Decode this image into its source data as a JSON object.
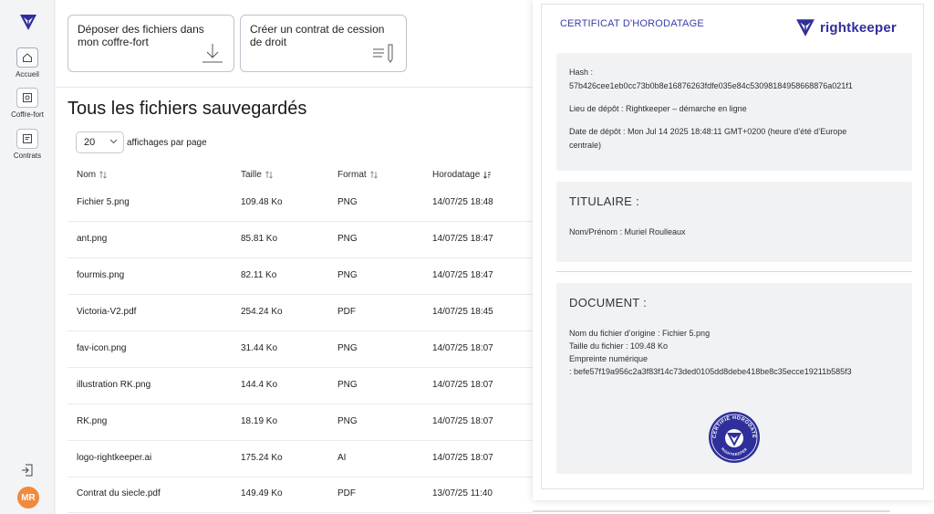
{
  "sidebar": {
    "items": [
      {
        "label": "Accueil",
        "icon": "home-icon"
      },
      {
        "label": "Coffre-fort",
        "icon": "safe-icon"
      },
      {
        "label": "Contrats",
        "icon": "contract-icon"
      }
    ],
    "avatar_initials": "MR"
  },
  "actions": {
    "upload_label": "Déposer des fichiers dans mon coffre-fort",
    "contract_label": "Créer un contrat de cession de droit"
  },
  "files": {
    "title": "Tous les fichiers sauvegardés",
    "page_size": "20",
    "page_size_label": "affichages par page",
    "columns": {
      "name": "Nom",
      "size": "Taille",
      "format": "Format",
      "date": "Horodatage"
    },
    "rows": [
      {
        "name": "Fichier 5.png",
        "size": "109.48 Ko",
        "format": "PNG",
        "date": "14/07/25 18:48"
      },
      {
        "name": "ant.png",
        "size": "85.81 Ko",
        "format": "PNG",
        "date": "14/07/25 18:47"
      },
      {
        "name": "fourmis.png",
        "size": "82.11 Ko",
        "format": "PNG",
        "date": "14/07/25 18:47"
      },
      {
        "name": "Victoria-V2.pdf",
        "size": "254.24 Ko",
        "format": "PDF",
        "date": "14/07/25 18:45"
      },
      {
        "name": "fav-icon.png",
        "size": "31.44 Ko",
        "format": "PNG",
        "date": "14/07/25 18:07"
      },
      {
        "name": "illustration RK.png",
        "size": "144.4 Ko",
        "format": "PNG",
        "date": "14/07/25 18:07"
      },
      {
        "name": "RK.png",
        "size": "18.19 Ko",
        "format": "PNG",
        "date": "14/07/25 18:07"
      },
      {
        "name": "logo-rightkeeper.ai",
        "size": "175.24 Ko",
        "format": "AI",
        "date": "14/07/25 18:07"
      },
      {
        "name": "Contrat du siecle.pdf",
        "size": "149.49 Ko",
        "format": "PDF",
        "date": "13/07/25 11:40"
      }
    ]
  },
  "certificate": {
    "title": "CERTIFICAT D'HORODATAGE",
    "brand": "rightkeeper",
    "hash_label": "Hash :",
    "hash_value": "57b426cee1eb0cc73b0b8e16876263fdfe035e84c530981849586688 76a021f1",
    "place": "Lieu de dépôt : Rightkeeper – démarche en ligne",
    "date_line1": "Date de dépôt : Mon Jul 14 2025 18:48:11 GMT+0200 (heure d’été d’Europe",
    "date_line2": "centrale)",
    "holder_heading": "TITULAIRE :",
    "holder_name": "Nom/Prénom : Muriel Roulleaux",
    "doc_heading": "DOCUMENT :",
    "doc_original": "Nom du fichier d’origine : Fichier 5.png",
    "doc_size": "Taille du fichier : 109.48 Ko",
    "doc_fingerprint_label": "Empreinte numérique",
    "doc_fingerprint_value": ": befe57f19a956c2a3f83f14c73ded0105dd8debe418be8c35ecce19211b585f3",
    "seal_text_top": "CERTIFIÉ HORODATÉ",
    "seal_text_bottom": "RIGHTKEEPER"
  },
  "colors": {
    "brand": "#2f2f9b",
    "avatar": "#f08a3c"
  }
}
